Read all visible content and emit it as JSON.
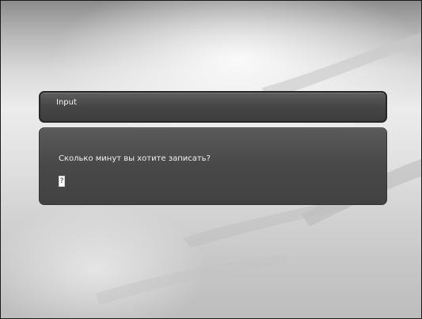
{
  "dialog": {
    "title": "Input",
    "prompt": "Сколько минут вы хотите записать?",
    "input": {
      "value": "?"
    }
  },
  "colors": {
    "panel": "#474747",
    "panel_border": "#262626",
    "text": "#f4f4f4",
    "background_light": "#ececec",
    "background_dark": "#8c8c8c"
  }
}
